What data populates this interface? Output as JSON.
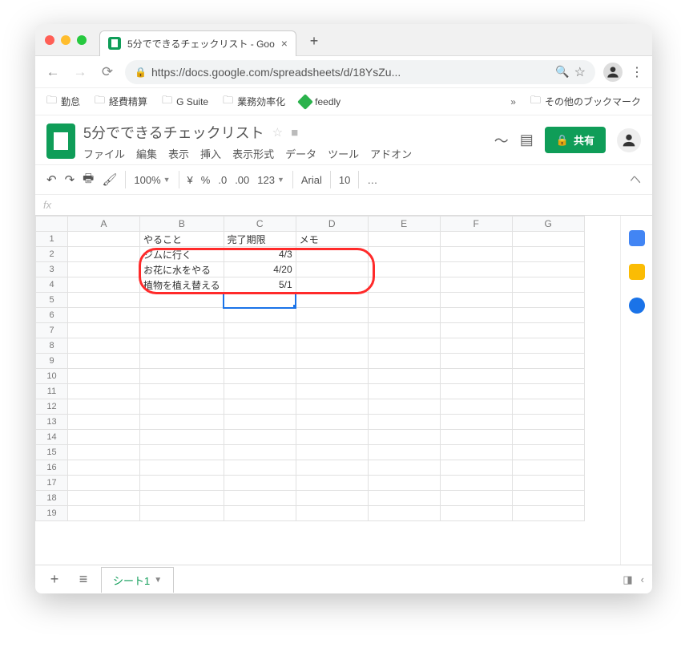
{
  "browser": {
    "tab_title": "5分でできるチェックリスト - Goo",
    "url_display": "https://docs.google.com/spreadsheets/d/18YsZu...",
    "bookmarks": [
      "勤怠",
      "経費精算",
      "G Suite",
      "業務効率化",
      "feedly"
    ],
    "bookmarks_other": "その他のブックマーク",
    "bookmarks_more": "»"
  },
  "sheets": {
    "doc_title": "5分でできるチェックリスト",
    "menus": [
      "ファイル",
      "編集",
      "表示",
      "挿入",
      "表示形式",
      "データ",
      "ツール",
      "アドオン"
    ],
    "share_label": "共有",
    "toolbar": {
      "zoom": "100%",
      "currency": "¥",
      "percent": "%",
      "dec_dec": ".0",
      "dec_inc": ".00",
      "numfmt": "123",
      "font": "Arial",
      "font_size": "10",
      "more": "…"
    },
    "fx_label": "fx",
    "columns": [
      "A",
      "B",
      "C",
      "D",
      "E",
      "F",
      "G"
    ],
    "row_count": 19,
    "cells": {
      "B1": "やること",
      "C1": "完了期限",
      "D1": "メモ",
      "B2": "ジムに行く",
      "C2": "4/3",
      "B3": "お花に水をやる",
      "C3": "4/20",
      "B4": "植物を植え替える",
      "C4": "5/1"
    },
    "selected_cell": "C5",
    "sheet_tab": "シート1"
  }
}
